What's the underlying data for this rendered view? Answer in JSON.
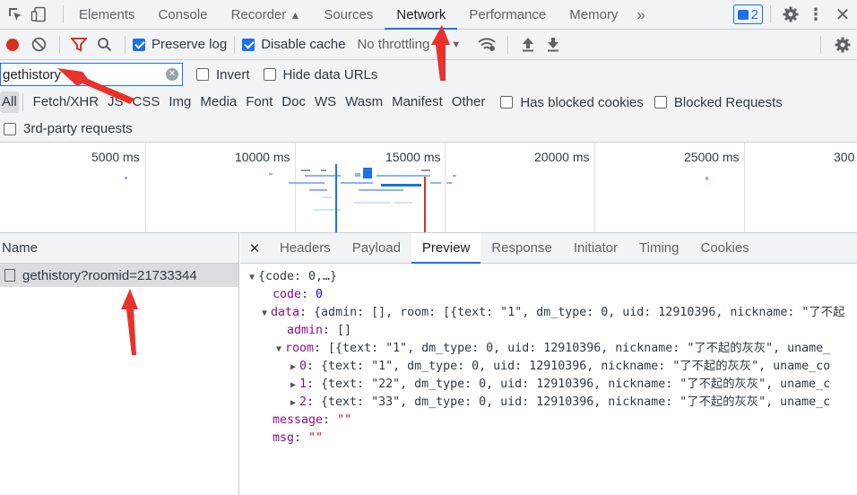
{
  "topbar": {
    "tabs": [
      "Elements",
      "Console",
      "Recorder",
      "Sources",
      "Network",
      "Performance",
      "Memory"
    ],
    "active_tab": "Network",
    "more": "»",
    "issues_count": "2"
  },
  "toolbar": {
    "preserve_log": "Preserve log",
    "disable_cache": "Disable cache",
    "throttling": "No throttling"
  },
  "filter": {
    "value": "gethistory",
    "invert": "Invert",
    "hide_data_urls": "Hide data URLs"
  },
  "types": [
    "All",
    "Fetch/XHR",
    "JS",
    "CSS",
    "Img",
    "Media",
    "Font",
    "Doc",
    "WS",
    "Wasm",
    "Manifest",
    "Other"
  ],
  "checks": {
    "has_blocked_cookies": "Has blocked cookies",
    "blocked_requests": "Blocked Requests",
    "third_party": "3rd-party requests"
  },
  "timeline": {
    "labels": [
      "5000 ms",
      "10000 ms",
      "15000 ms",
      "20000 ms",
      "25000 ms",
      "300"
    ]
  },
  "left": {
    "header": "Name",
    "request": "gethistory?roomid=21733344"
  },
  "detail_tabs": [
    "Headers",
    "Payload",
    "Preview",
    "Response",
    "Initiator",
    "Timing",
    "Cookies"
  ],
  "active_detail_tab": "Preview",
  "preview": {
    "root": "{code: 0,…}",
    "code_key": "code",
    "code_val": "0",
    "data_key": "data",
    "data_summary": "{admin: [], room: [{text: \"1\", dm_type: 0, uid: 12910396, nickname: \"了不起",
    "admin_key": "admin",
    "admin_val": "[]",
    "room_key": "room",
    "room_summary": "[{text: \"1\", dm_type: 0, uid: 12910396, nickname: \"了不起的灰灰\", uname_",
    "items": [
      {
        "idx": "0",
        "summary": "{text: \"1\", dm_type: 0, uid: 12910396, nickname: \"了不起的灰灰\", uname_co"
      },
      {
        "idx": "1",
        "summary": "{text: \"22\", dm_type: 0, uid: 12910396, nickname: \"了不起的灰灰\", uname_c"
      },
      {
        "idx": "2",
        "summary": "{text: \"33\", dm_type: 0, uid: 12910396, nickname: \"了不起的灰灰\", uname_c"
      }
    ],
    "message_key": "message",
    "message_val": "\"\"",
    "msg_key": "msg",
    "msg_val": "\"\""
  },
  "colors": {
    "accent": "#1a73e8",
    "record": "#d93025",
    "annotation": "#e8322b"
  }
}
